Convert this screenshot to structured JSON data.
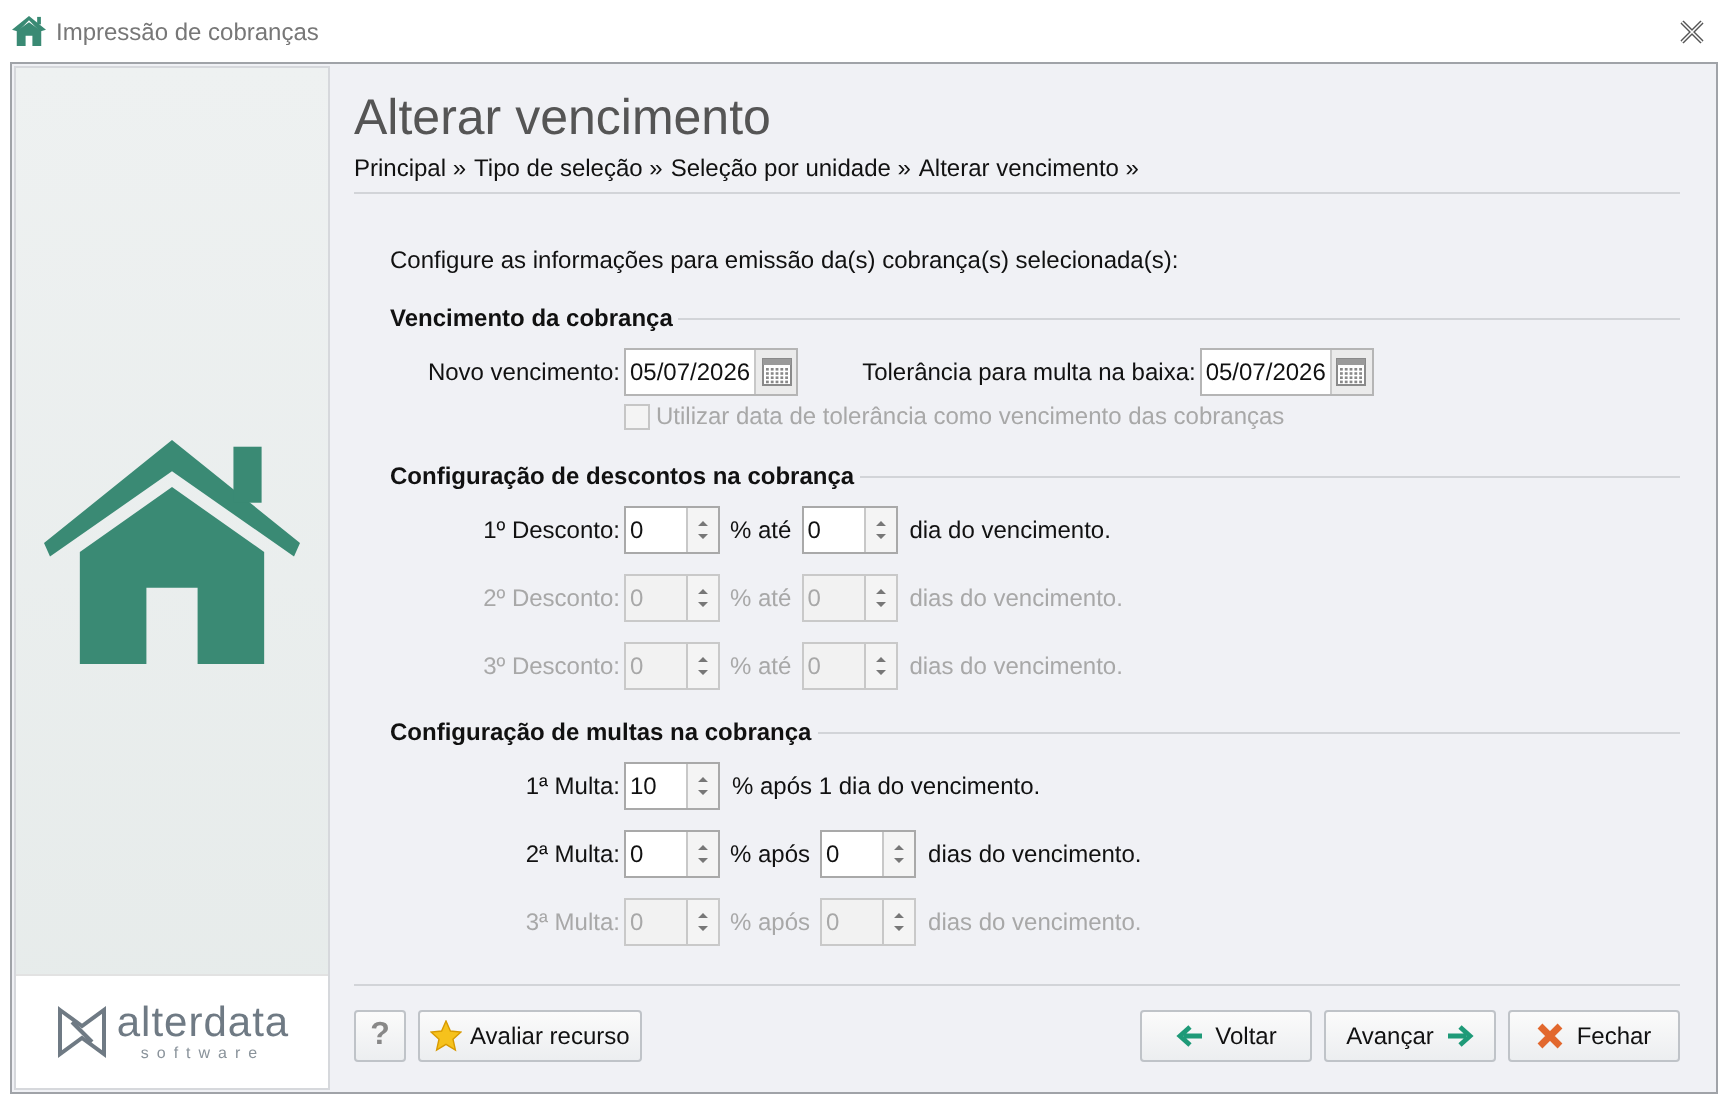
{
  "window": {
    "title": "Impressão de cobranças"
  },
  "logo": {
    "name": "alterdata",
    "tagline": "software"
  },
  "page": {
    "title": "Alterar vencimento",
    "breadcrumb": [
      "Principal »",
      "Tipo de seleção »",
      "Seleção por unidade »",
      "Alterar vencimento »"
    ]
  },
  "intro": "Configure as informações para emissão da(s) cobrança(s) selecionada(s):",
  "due": {
    "heading": "Vencimento da cobrança",
    "dates": [
      {
        "label": "Novo vencimento:",
        "value": "05/07/2026"
      },
      {
        "label": "Tolerância para multa na baixa:",
        "value": "05/07/2026"
      }
    ],
    "checkbox": {
      "label": "Utilizar data de tolerância como vencimento das cobranças",
      "checked": false,
      "disabled": true
    }
  },
  "sections": [
    {
      "heading": "Configuração de descontos na cobrança",
      "rows": [
        {
          "kind": "double",
          "label": "1º Desconto:",
          "value": "0",
          "middle": "% até",
          "value2": "0",
          "suffix": "dia do vencimento.",
          "disabled": false
        },
        {
          "kind": "double",
          "label": "2º Desconto:",
          "value": "0",
          "middle": "% até",
          "value2": "0",
          "suffix": "dias do vencimento.",
          "disabled": true
        },
        {
          "kind": "double",
          "label": "3º Desconto:",
          "value": "0",
          "middle": "% até",
          "value2": "0",
          "suffix": "dias do vencimento.",
          "disabled": true
        }
      ]
    },
    {
      "heading": "Configuração de multas na cobrança",
      "rows": [
        {
          "kind": "single",
          "label": "1ª Multa:",
          "value": "10",
          "suffix": "% após 1 dia do vencimento.",
          "disabled": false
        },
        {
          "kind": "double",
          "label": "2ª Multa:",
          "value": "0",
          "middle": "% após",
          "value2": "0",
          "suffix": "dias do vencimento.",
          "disabled": false
        },
        {
          "kind": "double",
          "label": "3ª Multa:",
          "value": "0",
          "middle": "% após",
          "value2": "0",
          "suffix": "dias do vencimento.",
          "disabled": true
        }
      ]
    }
  ],
  "footer": {
    "help": "?",
    "rate": "Avaliar recurso",
    "buttons": [
      {
        "kind": "back",
        "label": "Voltar"
      },
      {
        "kind": "next",
        "label": "Avançar"
      },
      {
        "kind": "close",
        "label": "Fechar"
      }
    ]
  }
}
